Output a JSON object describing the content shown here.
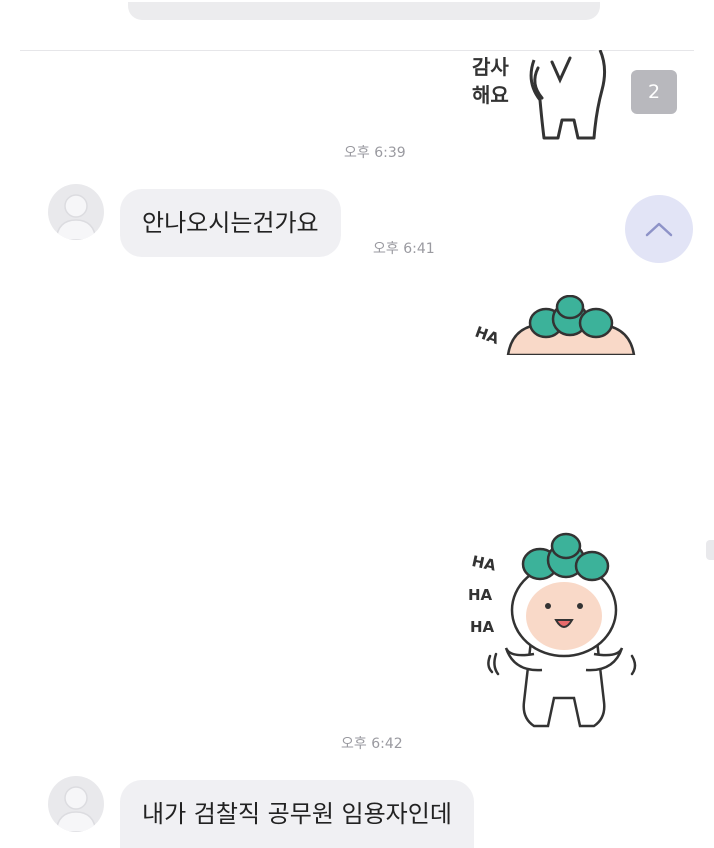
{
  "header": {
    "unread_badge": "2"
  },
  "stickers": [
    {
      "name": "thanks-sticker",
      "text_line1": "감사",
      "text_line2": "해요"
    },
    {
      "name": "laughing-sticker-cropped",
      "ha_labels": [
        "HA"
      ]
    },
    {
      "name": "laughing-sticker",
      "ha_labels": [
        "HA",
        "HA",
        "HA"
      ]
    }
  ],
  "messages": [
    {
      "time": "오후 6:39"
    },
    {
      "text": "안나오시는건가요",
      "time": "오후 6:41"
    },
    {
      "time": "오후 6:42"
    },
    {
      "text": "내가 검찰직 공무원 임용자인데"
    }
  ],
  "icons": {
    "scroll_up": "chevron-up-icon",
    "avatar": "user-avatar-icon"
  },
  "colors": {
    "bubble_bg": "#f0f0f3",
    "scroll_button_bg": "#e2e4f6",
    "sticker_leaf": "#3cb29a",
    "badge_bg": "#b8b8bd"
  }
}
